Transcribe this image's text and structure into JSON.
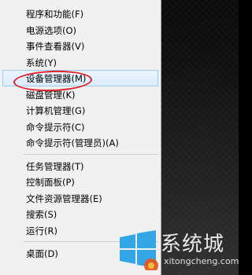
{
  "menu": {
    "items": [
      {
        "label": "程序和功能(F)"
      },
      {
        "label": "电源选项(O)"
      },
      {
        "label": "事件查看器(V)"
      },
      {
        "label": "系统(Y)"
      },
      {
        "label": "设备管理器(M)",
        "selected": true
      },
      {
        "label": "磁盘管理(K)"
      },
      {
        "label": "计算机管理(G)"
      },
      {
        "label": "命令提示符(C)"
      },
      {
        "label": "命令提示符(管理员)(A)"
      },
      {
        "label": "任务管理器(T)"
      },
      {
        "label": "控制面板(P)"
      },
      {
        "label": "文件资源管理器(E)"
      },
      {
        "label": "搜索(S)"
      },
      {
        "label": "运行(R)"
      },
      {
        "label": "桌面(D)"
      }
    ]
  },
  "watermark": {
    "brand": "系统城",
    "url": "xitongcheng.com"
  },
  "colors": {
    "menu_bg": "#f0f0f0",
    "selected_bg": "#dbecfb",
    "selected_border": "#9ecbf0",
    "highlight_ring": "#e0202a",
    "desktop_bg": "#0b0b0b"
  }
}
